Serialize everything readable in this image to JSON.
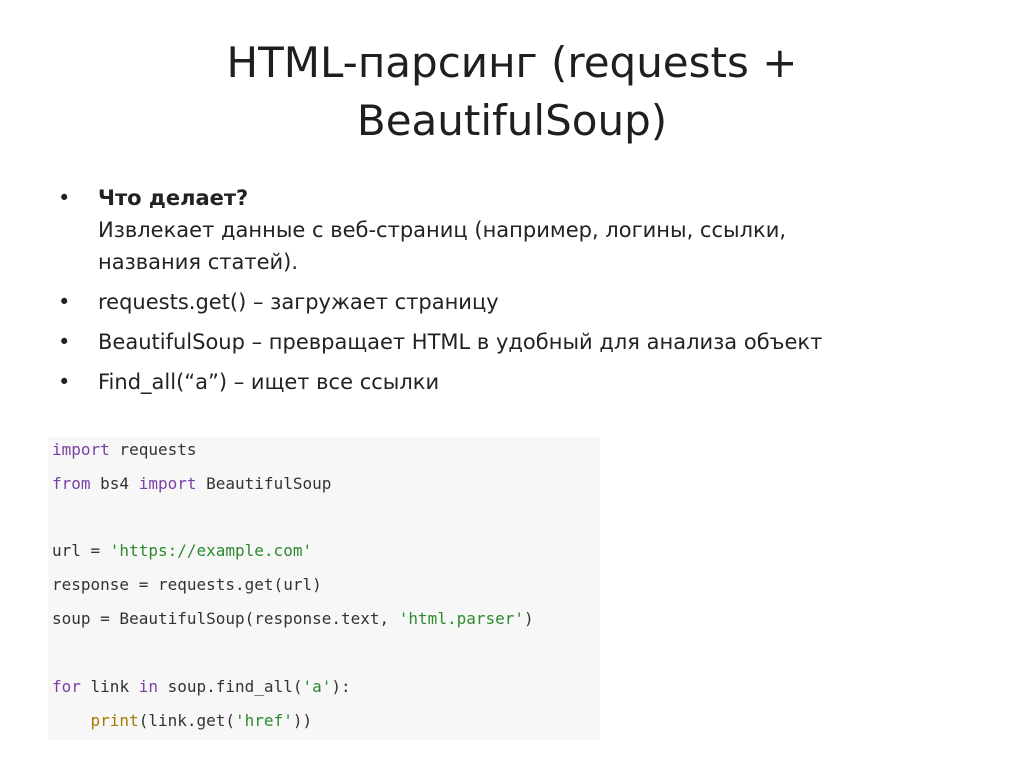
{
  "title": {
    "line1": "HTML-парсинг (requests +",
    "line2": "BeautifulSoup)"
  },
  "bullets": [
    {
      "heading": "Что делает?",
      "lines": [
        "Извлекает данные с веб-страниц (например, логины, ссылки,",
        "названия статей)."
      ]
    },
    {
      "text": "requests.get() – загружает страницу"
    },
    {
      "text": "BeautifulSoup – превращает HTML в удобный для анализа объект"
    },
    {
      "text": "Find_all(“a”) – ищет все ссылки"
    }
  ],
  "bullet_symbol": "•",
  "code": {
    "line1": {
      "kw1": "import",
      "rest": " requests"
    },
    "line2": {
      "kw1": "from",
      "mid": " bs4 ",
      "kw2": "import",
      "rest": " BeautifulSoup"
    },
    "line4": {
      "pre": "url = ",
      "str": "'https://example.com'"
    },
    "line5": {
      "text": "response = requests.get(url)"
    },
    "line6": {
      "pre": "soup = BeautifulSoup(response.text, ",
      "str": "'html.parser'",
      "post": ")"
    },
    "line8": {
      "kw1": "for",
      "mid": " link ",
      "kw2": "in",
      "pre2": " soup.find_all(",
      "str": "'a'",
      "post": "):"
    },
    "line9": {
      "indent": "    ",
      "fn": "print",
      "pre": "(link.get(",
      "str": "'href'",
      "post": "))"
    }
  },
  "colors": {
    "keyword": "#7b40a8",
    "string": "#2d8a2d",
    "builtin": "#a67a00",
    "code_background": "#f7f7f7"
  }
}
